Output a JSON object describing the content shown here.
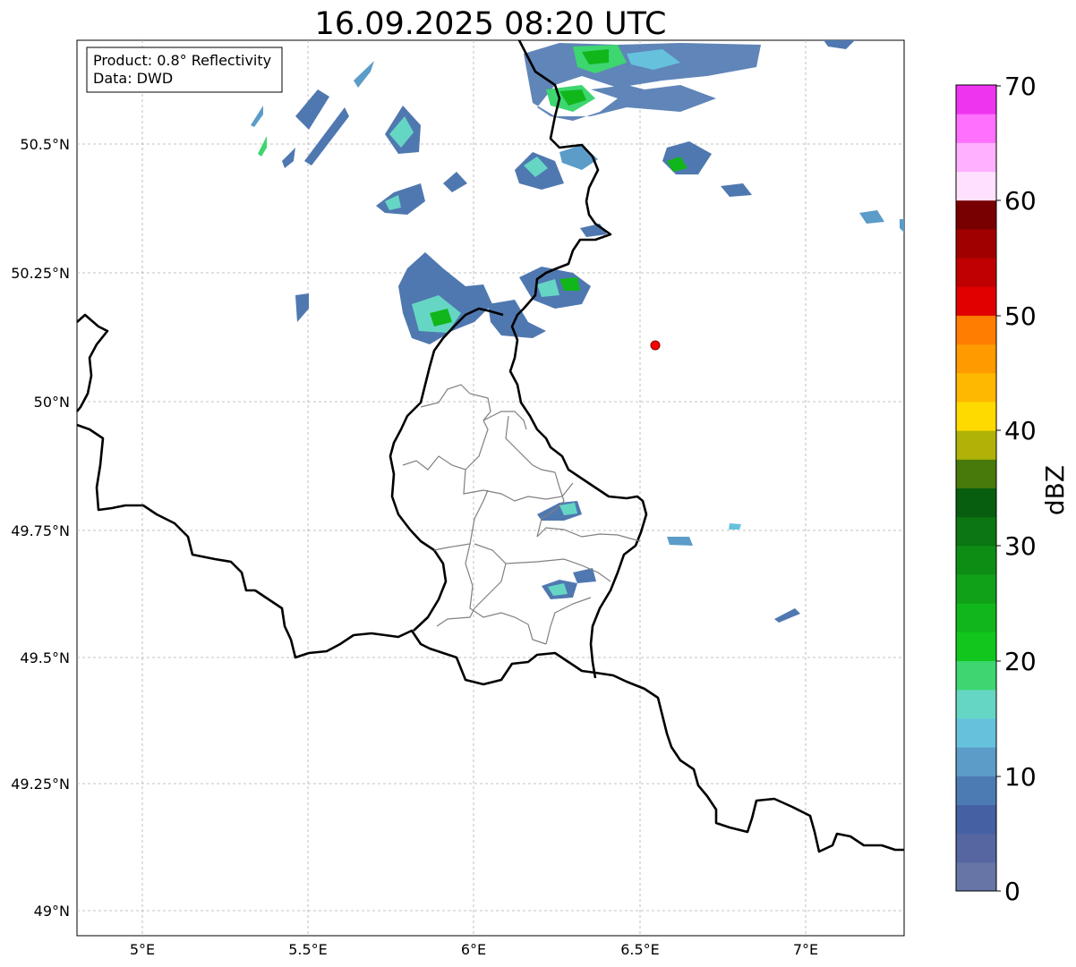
{
  "title": "16.09.2025 08:20 UTC",
  "info": {
    "product": "Product: 0.8° Reflectivity",
    "source": "Data: DWD"
  },
  "axes": {
    "lon_ticks": [
      "5°E",
      "5.5°E",
      "6°E",
      "6.5°E",
      "7°E"
    ],
    "lat_ticks": [
      "49°N",
      "49.25°N",
      "49.5°N",
      "49.75°N",
      "50°N",
      "50.25°N",
      "50.5°N"
    ]
  },
  "colorbar": {
    "label": "dBZ",
    "ticks": [
      "0",
      "10",
      "20",
      "30",
      "40",
      "50",
      "60",
      "70"
    ],
    "colors": [
      "#6674a6",
      "#5566a1",
      "#4560a3",
      "#4c7bb3",
      "#5b9cc8",
      "#66c2dc",
      "#66d6c4",
      "#3dd670",
      "#11c61c",
      "#11b61b",
      "#10a118",
      "#0e8d15",
      "#0b7612",
      "#075e0e",
      "#477a0b",
      "#b0b207",
      "#ffda00",
      "#ffb800",
      "#ff9a00",
      "#ff7d00",
      "#e10000",
      "#c00000",
      "#a00000",
      "#780000",
      "#ffe0ff",
      "#ffb0ff",
      "#ff70ff",
      "#ee34ee"
    ]
  },
  "marker": {
    "label": "radar-site",
    "color": "#ff0000"
  }
}
